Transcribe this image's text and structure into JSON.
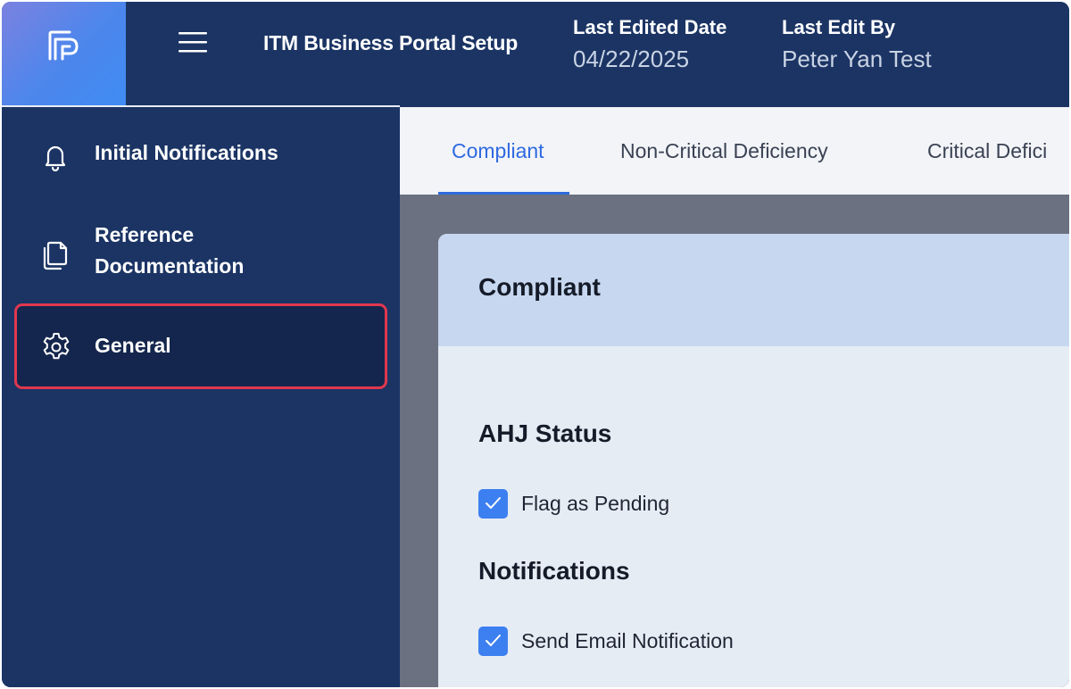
{
  "header": {
    "app_title": "ITM Business Portal Setup",
    "last_edited_label": "Last Edited Date",
    "last_edited_value": "04/22/2025",
    "last_edit_by_label": "Last Edit By",
    "last_edit_by_value": "Peter Yan Test",
    "menu_icon": "hamburger-menu-icon",
    "logo_icon": "app-logo-icon"
  },
  "sidebar": {
    "items": [
      {
        "label": "Initial Notifications",
        "icon": "bell-icon",
        "active": false
      },
      {
        "label": "Reference\nDocumentation",
        "icon": "documents-icon",
        "active": false
      },
      {
        "label": "General",
        "icon": "gear-icon",
        "active": true
      }
    ]
  },
  "tabs": [
    {
      "label": "Compliant",
      "active": true
    },
    {
      "label": "Non-Critical Deficiency",
      "active": false
    },
    {
      "label": "Critical Defici",
      "active": false
    }
  ],
  "card": {
    "title": "Compliant",
    "sections": [
      {
        "title": "AHJ Status",
        "options": [
          {
            "label": "Flag as Pending",
            "checked": true
          }
        ]
      },
      {
        "title": "Notifications",
        "options": [
          {
            "label": "Send Email Notification",
            "checked": true
          }
        ]
      }
    ]
  },
  "colors": {
    "header_bg": "#1b3464",
    "accent_blue": "#2f6ae0",
    "checkbox_blue": "#3c7ff0",
    "highlight_red": "#e0384f"
  }
}
